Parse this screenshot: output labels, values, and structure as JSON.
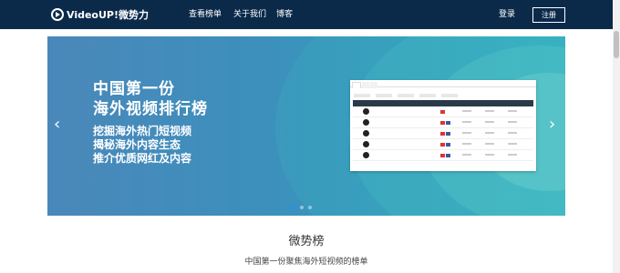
{
  "navbar": {
    "logo_text": "VideoUP!微势力",
    "links": [
      "查看榜单",
      "关于我们",
      "博客"
    ],
    "login": "登录",
    "register": "注册"
  },
  "banner": {
    "title_line1": "中国第一份",
    "title_line2": "海外视频排行榜",
    "sub_line1": "挖掘海外热门短视频",
    "sub_line2": "揭秘海外内容生态",
    "sub_line3": "推介优质网红及内容",
    "prev_icon": "‹",
    "next_icon": "›",
    "slide_count": 3,
    "active_slide": 1
  },
  "section": {
    "title": "微势榜",
    "subtitle": "中国第一份聚焦海外短视频的榜单"
  }
}
